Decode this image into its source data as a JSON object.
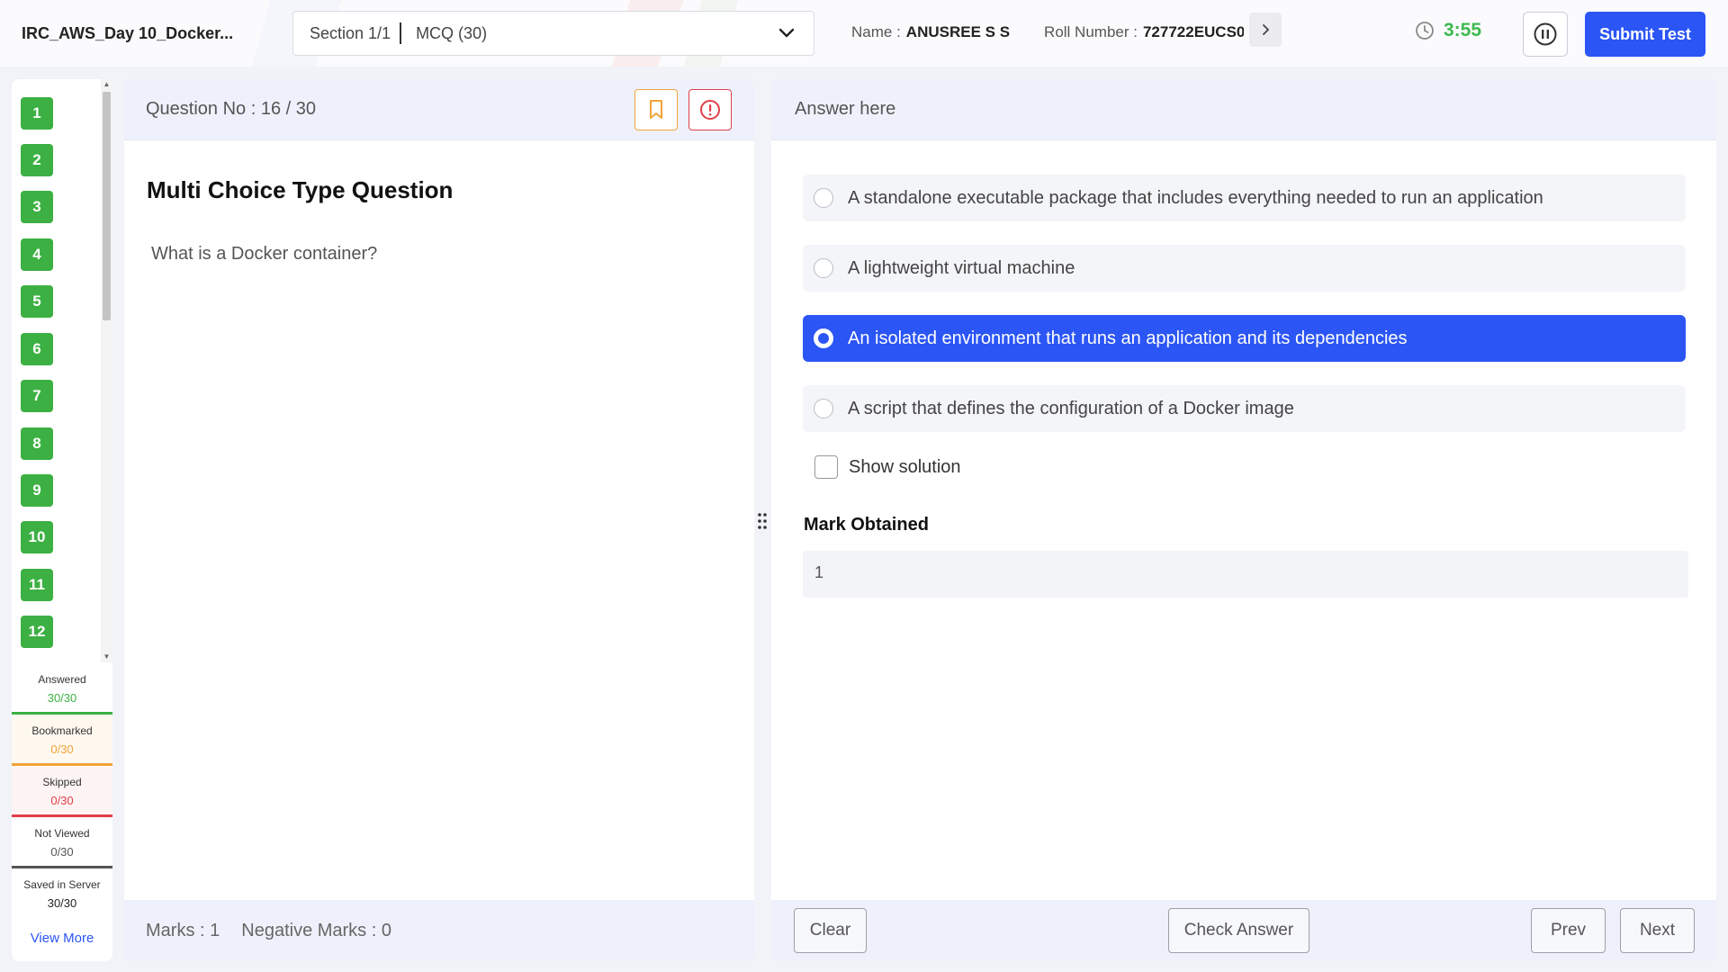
{
  "header": {
    "test_title": "IRC_AWS_Day 10_Docker...",
    "section_label": "Section 1/1",
    "section_value": "MCQ (30)",
    "name_label": "Name :",
    "name_value": "ANUSREE S S",
    "roll_label": "Roll Number :",
    "roll_value": "727722EUCS0",
    "timer": "3:55",
    "submit_label": "Submit Test"
  },
  "sidebar": {
    "questions": [
      "1",
      "2",
      "3",
      "4",
      "5",
      "6",
      "7",
      "8",
      "9",
      "10",
      "11",
      "12"
    ],
    "stats": [
      {
        "label": "Answered",
        "count": "30/30",
        "color": "#3cb043"
      },
      {
        "label": "Bookmarked",
        "count": "0/30",
        "color": "#f2a33a"
      },
      {
        "label": "Skipped",
        "count": "0/30",
        "color": "#e0404a"
      },
      {
        "label": "Not Viewed",
        "count": "0/30",
        "color": "#555555"
      },
      {
        "label": "Saved in Server",
        "count": "30/30",
        "color": "#ffffff"
      }
    ],
    "view_more": "View More"
  },
  "question": {
    "number_text": "Question No : 16 / 30",
    "type": "Multi Choice Type Question",
    "text": "What is a Docker container?",
    "marks": "Marks : 1",
    "negative_marks": "Negative Marks : 0"
  },
  "answer": {
    "header": "Answer here",
    "options": [
      "A standalone executable package that includes everything needed to run an application",
      "A lightweight virtual machine",
      "An isolated environment that runs an application and its dependencies",
      "A script that defines the configuration of a Docker image"
    ],
    "selected_index": 2,
    "show_solution": "Show solution",
    "mark_obtained_label": "Mark Obtained",
    "mark_obtained_value": "1",
    "clear_label": "Clear",
    "check_label": "Check Answer",
    "prev_label": "Prev",
    "next_label": "Next"
  },
  "colors": {
    "accent": "#2b55f5",
    "answered": "#3cb043",
    "timer": "#3fb950",
    "bookmark": "#f2a33a",
    "report": "#e0404a"
  }
}
